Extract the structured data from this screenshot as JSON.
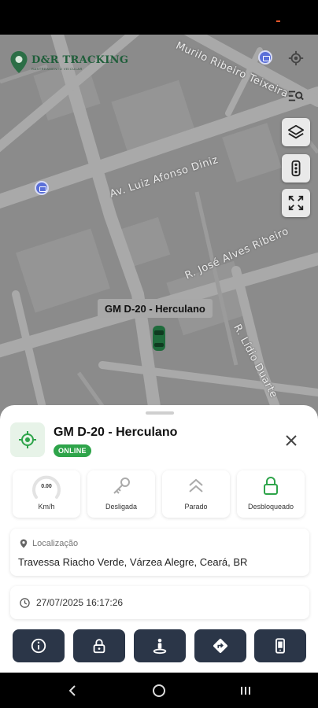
{
  "app": {
    "brand_name": "D&R TRACKING",
    "brand_subtitle": "RASTREAMENTO VEICULAR"
  },
  "map": {
    "streets": [
      "Murilo Ribeiro Teixeira",
      "Av. Luiz Afonso Diniz",
      "R. José Alves Ribeiro",
      "R. Lídio Duarte"
    ],
    "vehicle_label": "GM D-20 - Herculano",
    "controls": [
      "my-location-icon",
      "search-list-icon",
      "layers-icon",
      "traffic-light-icon",
      "fullscreen-icon"
    ]
  },
  "vehicle": {
    "name": "GM D-20 - Herculano",
    "status": "ONLINE",
    "accent_color": "#2ea44a"
  },
  "status_cards": {
    "speed": {
      "value": "0.00",
      "unit": "Km/h"
    },
    "ignition": {
      "label": "Desligada",
      "icon": "key-icon"
    },
    "motion": {
      "label": "Parado",
      "icon": "chevrons-up-icon"
    },
    "lock": {
      "label": "Desbloqueado",
      "icon": "unlock-icon"
    }
  },
  "location": {
    "heading": "Localização",
    "address": "Travessa Riacho Verde, Várzea Alegre, Ceará, BR"
  },
  "timestamp": "27/07/2025 16:17:26",
  "actions": [
    "info-icon",
    "lock-icon",
    "street-view-icon",
    "directions-icon",
    "phone-icon"
  ],
  "colors": {
    "action_button": "#2b3648",
    "brand_green": "#1f5e3a"
  }
}
